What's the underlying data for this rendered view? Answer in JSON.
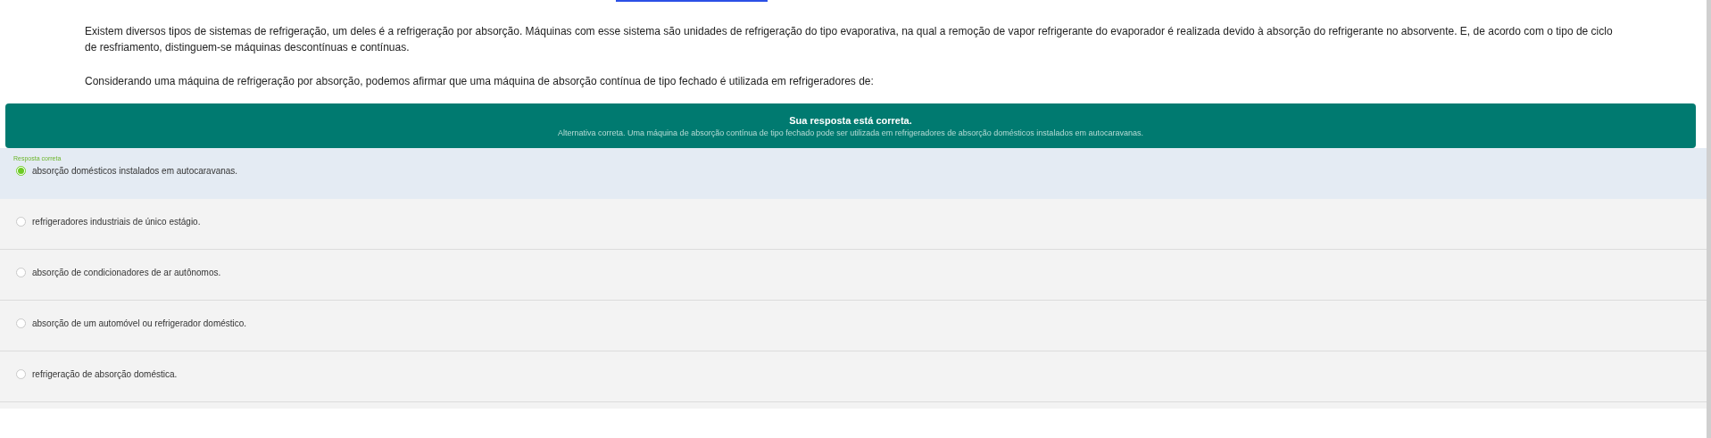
{
  "question": {
    "paragraphs": [
      "Existem diversos tipos de sistemas de refrigeração, um deles é a refrigeração por absorção. Máquinas com esse sistema são unidades de refrigeração do tipo evaporativa, na qual a remoção de vapor refrigerante do evaporador é realizada devido à absorção do refrigerante no absorvente. E, de acordo com o tipo de ciclo de resfriamento, distinguem-se máquinas descontínuas e contínuas.",
      "Considerando uma máquina de refrigeração por absorção, podemos afirmar que uma máquina de absorção contínua de tipo fechado é utilizada em refrigeradores de:"
    ]
  },
  "feedback": {
    "title": "Sua resposta está correta.",
    "message": "Alternativa correta. Uma máquina de absorção contínua de tipo fechado pode ser utilizada em refrigeradores de absorção domésticos instalados em autocaravanas."
  },
  "options": [
    {
      "label": "absorção domésticos instalados em autocaravanas.",
      "selected": true,
      "note": "Resposta correta"
    },
    {
      "label": "refrigeradores industriais de único estágio.",
      "selected": false
    },
    {
      "label": "absorção de condicionadores de ar autônomos.",
      "selected": false
    },
    {
      "label": "absorção de um automóvel ou refrigerador doméstico.",
      "selected": false
    },
    {
      "label": "refrigeração de absorção doméstica.",
      "selected": false
    }
  ]
}
